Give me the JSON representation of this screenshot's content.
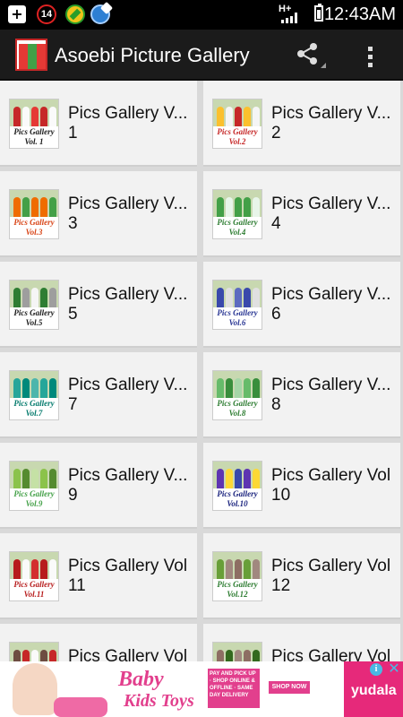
{
  "status_bar": {
    "notification_count": "14",
    "network": "H+",
    "time": "12:43AM",
    "icons": [
      "shield-plus-icon",
      "notification-count-icon",
      "green-app-icon",
      "globe-icon",
      "signal-icon",
      "battery-icon"
    ]
  },
  "app_bar": {
    "title": "Asoebi Picture Gallery",
    "share_icon": "share-icon",
    "menu_icon": "overflow-menu-icon"
  },
  "accent_colors": {
    "app_bar": "#1b1b1b",
    "card_bg": "#f2f2f2",
    "grid_bg": "#d9d9d9"
  },
  "gallery": {
    "items": [
      {
        "title": "Pics Gallery V...",
        "number": "1",
        "caption": "Pics Gallery",
        "vol": "Vol. 1",
        "caption_color": "#1a1a1a"
      },
      {
        "title": "Pics Gallery V...",
        "number": "2",
        "caption": "Pics Gallery",
        "vol": "Vol.2",
        "caption_color": "#c62828"
      },
      {
        "title": "Pics Gallery V...",
        "number": "3",
        "caption": "Pics Gallery",
        "vol": "Vol.3",
        "caption_color": "#d84315"
      },
      {
        "title": "Pics Gallery V...",
        "number": "4",
        "caption": "Pics Gallery",
        "vol": "Vol.4",
        "caption_color": "#2e7d32"
      },
      {
        "title": "Pics Gallery V...",
        "number": "5",
        "caption": "Pics Gallery",
        "vol": "Vol.5",
        "caption_color": "#1a1a1a"
      },
      {
        "title": "Pics Gallery V...",
        "number": "6",
        "caption": "Pics Gallery",
        "vol": "Vol.6",
        "caption_color": "#283593"
      },
      {
        "title": "Pics Gallery V...",
        "number": "7",
        "caption": "Pics Gallery",
        "vol": "Vol.7",
        "caption_color": "#00796b"
      },
      {
        "title": "Pics Gallery V...",
        "number": "8",
        "caption": "Pics Gallery",
        "vol": "Vol.8",
        "caption_color": "#2e7d32"
      },
      {
        "title": "Pics Gallery V...",
        "number": "9",
        "caption": "Pics Gallery",
        "vol": "Vol.9",
        "caption_color": "#43a047"
      },
      {
        "title": "Pics Gallery Vol",
        "number": "10",
        "caption": "Pics Gallery",
        "vol": "Vol.10",
        "caption_color": "#1a237e"
      },
      {
        "title": "Pics Gallery Vol",
        "number": "11",
        "caption": "Pics Gallery",
        "vol": "Vol.11",
        "caption_color": "#b71c1c"
      },
      {
        "title": "Pics Gallery Vol",
        "number": "12",
        "caption": "Pics Gallery",
        "vol": "Vol.12",
        "caption_color": "#2e7d32"
      },
      {
        "title": "Pics Gallery Vol",
        "number": "",
        "caption": "",
        "vol": "",
        "caption_color": "#1a1a1a"
      },
      {
        "title": "Pics Gallery Vol",
        "number": "",
        "caption": "",
        "vol": "",
        "caption_color": "#1a1a1a"
      }
    ]
  },
  "ad": {
    "brand_line1": "Baby",
    "brand_line2": "Kids Toys",
    "promo": "PAY AND PICK UP · SHOP ONLINE & OFFLINE · SAME DAY DELIVERY",
    "cta": "SHOP NOW",
    "advertiser": "yudala",
    "info_label": "i",
    "close_label": "✕"
  }
}
